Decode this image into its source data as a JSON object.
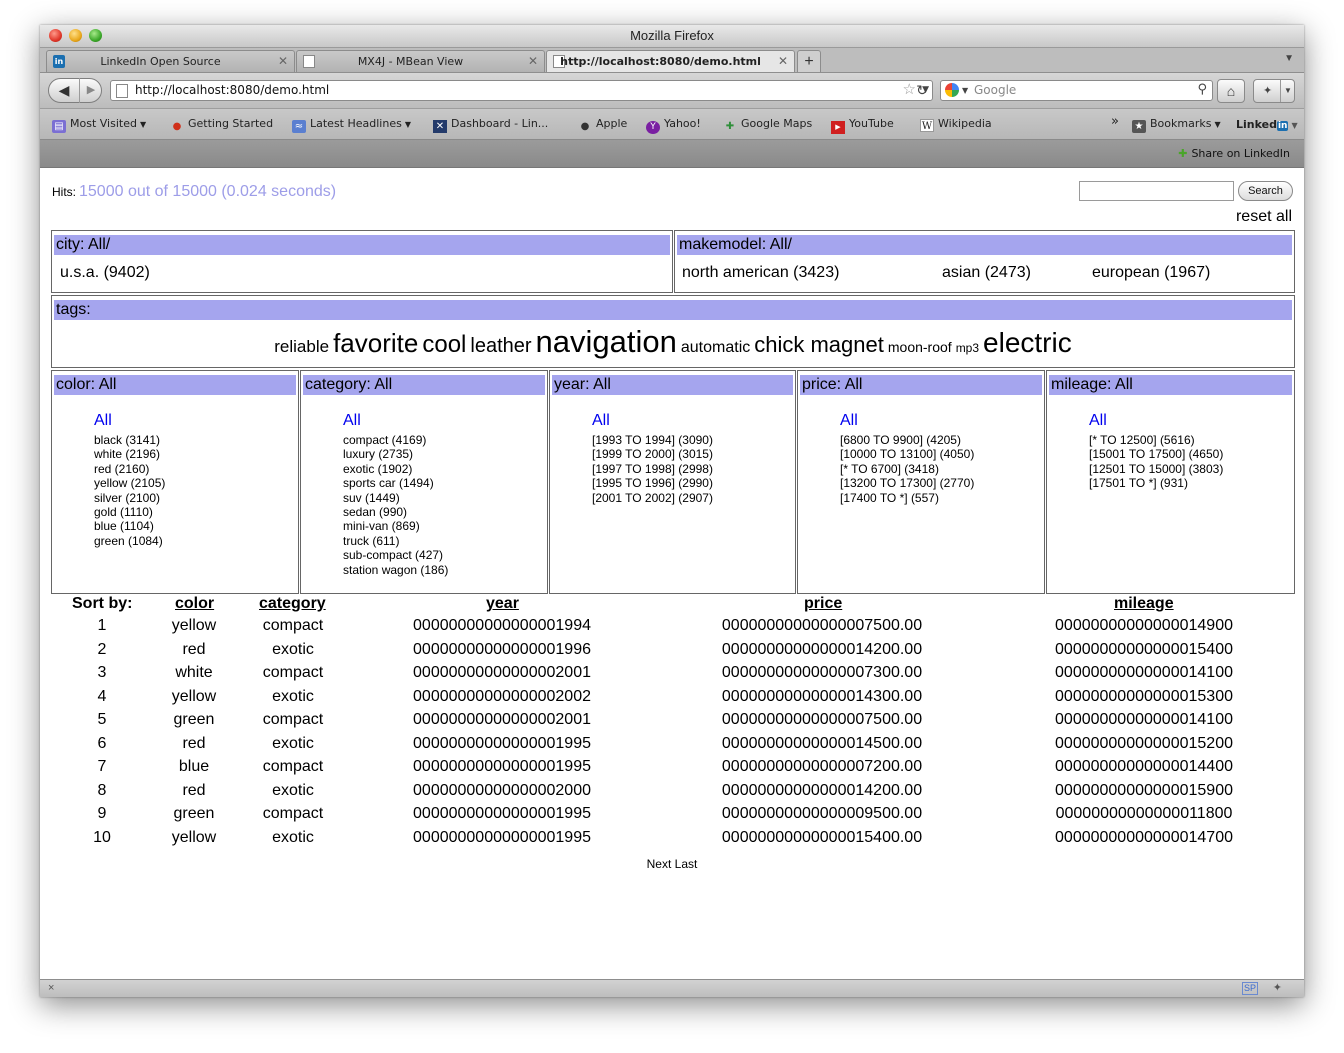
{
  "window": {
    "title": "Mozilla Firefox"
  },
  "tabs": [
    {
      "label": "LinkedIn Open Source",
      "icon": "linkedin-icon",
      "active": false
    },
    {
      "label": "MX4J - MBean View",
      "icon": "page-icon",
      "active": false
    },
    {
      "label": "http://localhost:8080/demo.html",
      "icon": "page-icon",
      "active": true
    }
  ],
  "navbar": {
    "url": "http://localhost:8080/demo.html",
    "search_placeholder": "Google"
  },
  "bookmarks": [
    {
      "label": "Most Visited",
      "icon": "most-visited-icon",
      "chevron": true
    },
    {
      "label": "Getting Started",
      "icon": "firefox-icon",
      "chevron": false
    },
    {
      "label": "Latest Headlines",
      "icon": "rss-icon",
      "chevron": true
    },
    {
      "label": "Dashboard - Lin...",
      "icon": "confluence-icon",
      "chevron": false
    },
    {
      "label": "Apple",
      "icon": "apple-icon",
      "chevron": false
    },
    {
      "label": "Yahoo!",
      "icon": "yahoo-icon",
      "chevron": false
    },
    {
      "label": "Google Maps",
      "icon": "google-maps-icon",
      "chevron": false
    },
    {
      "label": "YouTube",
      "icon": "youtube-icon",
      "chevron": false
    },
    {
      "label": "Wikipedia",
      "icon": "wikipedia-icon",
      "chevron": false
    }
  ],
  "bookmarks_overflow": "»",
  "bookmarks_menu": "Bookmarks",
  "linkedin_button": "Linked",
  "linkedin_button_in": "in",
  "share_linkedin": "Share on LinkedIn",
  "page": {
    "hits_label": "Hits:",
    "hits_value": "15000 out of 15000 (0.024 seconds)",
    "search_button": "Search",
    "reset_all": "reset all",
    "city": {
      "header": "city: All/",
      "items": [
        "u.s.a. (9402)"
      ]
    },
    "makemodel": {
      "header": "makemodel: All/",
      "items": [
        "north american (3423)",
        "asian (2473)",
        "european (1967)"
      ]
    },
    "tags": {
      "header": "tags:",
      "cloud": [
        {
          "text": "reliable",
          "size": 17
        },
        {
          "text": "favorite",
          "size": 26
        },
        {
          "text": "cool",
          "size": 24
        },
        {
          "text": "leather",
          "size": 20
        },
        {
          "text": "navigation",
          "size": 31
        },
        {
          "text": "automatic",
          "size": 16
        },
        {
          "text": "chick magnet",
          "size": 22
        },
        {
          "text": "moon-roof",
          "size": 14
        },
        {
          "text": "mp3",
          "size": 12
        },
        {
          "text": "electric",
          "size": 28
        }
      ]
    },
    "facets": [
      {
        "header": "color: All",
        "all": "All",
        "items": [
          "black (3141)",
          "white (2196)",
          "red (2160)",
          "yellow (2105)",
          "silver (2100)",
          "gold (1110)",
          "blue (1104)",
          "green (1084)"
        ]
      },
      {
        "header": "category: All",
        "all": "All",
        "items": [
          "compact (4169)",
          "luxury (2735)",
          "exotic (1902)",
          "sports car (1494)",
          "suv (1449)",
          "sedan (990)",
          "mini-van (869)",
          "truck (611)",
          "sub-compact (427)",
          "station wagon (186)"
        ]
      },
      {
        "header": "year: All",
        "all": "All",
        "items": [
          "[1993 TO 1994] (3090)",
          "[1999 TO 2000] (3015)",
          "[1997 TO 1998] (2998)",
          "[1995 TO 1996] (2990)",
          "[2001 TO 2002] (2907)"
        ]
      },
      {
        "header": "price: All",
        "all": "All",
        "items": [
          "[6800 TO 9900] (4205)",
          "[10000 TO 13100] (4050)",
          "[* TO 6700] (3418)",
          "[13200 TO 17300] (2770)",
          "[17400 TO *] (557)"
        ]
      },
      {
        "header": "mileage: All",
        "all": "All",
        "items": [
          "[* TO 12500] (5616)",
          "[15001 TO 17500] (4650)",
          "[12501 TO 15000] (3803)",
          "[17501 TO *] (931)"
        ]
      }
    ],
    "results": {
      "sort_label": "Sort by:",
      "columns": [
        "color",
        "category",
        "year",
        "price",
        "mileage"
      ],
      "rows": [
        [
          "1",
          "yellow",
          "compact",
          "00000000000000001994",
          "00000000000000007500.00",
          "00000000000000014900"
        ],
        [
          "2",
          "red",
          "exotic",
          "00000000000000001996",
          "00000000000000014200.00",
          "00000000000000015400"
        ],
        [
          "3",
          "white",
          "compact",
          "00000000000000002001",
          "00000000000000007300.00",
          "00000000000000014100"
        ],
        [
          "4",
          "yellow",
          "exotic",
          "00000000000000002002",
          "00000000000000014300.00",
          "00000000000000015300"
        ],
        [
          "5",
          "green",
          "compact",
          "00000000000000002001",
          "00000000000000007500.00",
          "00000000000000014100"
        ],
        [
          "6",
          "red",
          "exotic",
          "00000000000000001995",
          "00000000000000014500.00",
          "00000000000000015200"
        ],
        [
          "7",
          "blue",
          "compact",
          "00000000000000001995",
          "00000000000000007200.00",
          "00000000000000014400"
        ],
        [
          "8",
          "red",
          "exotic",
          "00000000000000002000",
          "00000000000000014200.00",
          "00000000000000015900"
        ],
        [
          "9",
          "green",
          "compact",
          "00000000000000001995",
          "00000000000000009500.00",
          "00000000000000011800"
        ],
        [
          "10",
          "yellow",
          "exotic",
          "00000000000000001995",
          "00000000000000015400.00",
          "00000000000000014700"
        ]
      ]
    },
    "pager": "Next Last"
  },
  "statusbar": {
    "close": "×",
    "badge": "SP"
  },
  "colors": {
    "facet_header": "#a5a5ee",
    "hits_value": "#9d9de8",
    "link": "#0000ee"
  }
}
